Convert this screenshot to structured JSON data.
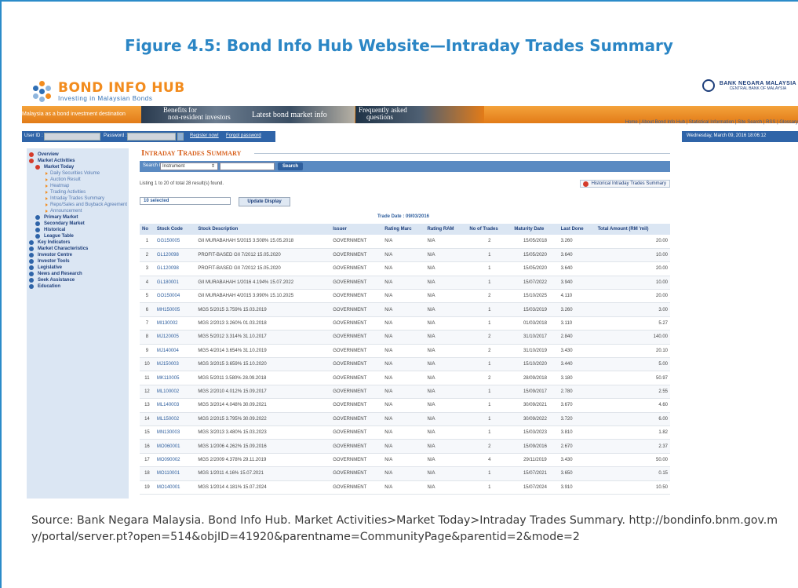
{
  "figure_title": "Figure 4.5: Bond Info Hub Website—Intraday Trades Summary",
  "site": {
    "logo_name_1": "BOND ",
    "logo_name_2": "INFO HUB",
    "logo_tagline": "Investing in Malaysian Bonds",
    "bnm_name": "BANK NEGARA MALAYSIA",
    "bnm_sub": "CENTRAL BANK OF MALAYSIA",
    "top_links": "Home | About Bond Info Hub | Statistical Information | Site Search | RSS | Glossary",
    "banner_tagline": "Malaysia as a bond investment destination",
    "banner_item_1a": "Benefits for",
    "banner_item_1b": "non-resident investors",
    "banner_item_2": "Latest bond market info",
    "banner_item_3a": "Frequently asked",
    "banner_item_3b": "questions"
  },
  "login": {
    "user_label": "User ID :",
    "password_label": "Password :",
    "register": "Register now!",
    "forgot": "Forgot password"
  },
  "date_display": "Wednesday, March 09, 2016 18:06:12",
  "sidebar": [
    {
      "label": "Overview",
      "level": "top"
    },
    {
      "label": "Market Activities",
      "level": "top"
    },
    {
      "label": "Market Today",
      "level": "l1"
    },
    {
      "label": "Daily Securities Volume",
      "level": "l2"
    },
    {
      "label": "Auction Result",
      "level": "l2"
    },
    {
      "label": "Heatmap",
      "level": "l2"
    },
    {
      "label": "Trading Activities",
      "level": "l2"
    },
    {
      "label": "Intraday Trades Summary",
      "level": "l2"
    },
    {
      "label": "Repo/Sales and Buyback Agreement",
      "level": "l2"
    },
    {
      "label": "Announcement",
      "level": "l2"
    },
    {
      "label": "Primary Market",
      "level": "l1b"
    },
    {
      "label": "Secondary Market",
      "level": "l1b"
    },
    {
      "label": "Historical",
      "level": "l1b"
    },
    {
      "label": "League Table",
      "level": "l1b"
    },
    {
      "label": "Key Indicators",
      "level": "base"
    },
    {
      "label": "Market Characteristics",
      "level": "base"
    },
    {
      "label": "Investor Centre",
      "level": "base"
    },
    {
      "label": "Investor Tools",
      "level": "base"
    },
    {
      "label": "Legislative",
      "level": "base"
    },
    {
      "label": "News and Research",
      "level": "base"
    },
    {
      "label": "Seek Assistance",
      "level": "base"
    },
    {
      "label": "Education",
      "level": "base"
    }
  ],
  "panel": {
    "title": "Intraday Trades Summary",
    "search_label": "Search by",
    "search_select": "Instrument",
    "search_button": "Search",
    "listing_text": "Listing 1 to 20  of total 28 result(s) found.",
    "historical_link": "Historical Intraday Trades Summary",
    "selected_text": "10 selected",
    "update_button": "Update Display",
    "trade_date": "Trade Date : 09/03/2016"
  },
  "table": {
    "columns": [
      "No",
      "Stock Code",
      "Stock Description",
      "Issuer",
      "Rating Marc",
      "Rating RAM",
      "No of Trades",
      "Maturity Date",
      "Last Done",
      "Total Amount (RM 'mil)"
    ],
    "rows": [
      [
        "1",
        "GG150005",
        "GII MURABAHAH 5/2015 3.508% 15.05.2018",
        "GOVERNMENT",
        "N/A",
        "N/A",
        "2",
        "15/05/2018",
        "3.260",
        "20.00"
      ],
      [
        "2",
        "GL120098",
        "PROFIT-BASED GII 7/2012 15.05.2020",
        "GOVERNMENT",
        "N/A",
        "N/A",
        "1",
        "15/05/2020",
        "3.640",
        "10.00"
      ],
      [
        "3",
        "GL120098",
        "PROFIT-BASED GII 7/2012 15.05.2020",
        "GOVERNMENT",
        "N/A",
        "N/A",
        "1",
        "15/05/2020",
        "3.640",
        "20.00"
      ],
      [
        "4",
        "GL180001",
        "GII MURABAHAH 1/2016 4.194% 15.07.2022",
        "GOVERNMENT",
        "N/A",
        "N/A",
        "1",
        "15/07/2022",
        "3.940",
        "10.00"
      ],
      [
        "5",
        "GO150004",
        "GII MURABAHAH 4/2015 3.990% 15.10.2025",
        "GOVERNMENT",
        "N/A",
        "N/A",
        "2",
        "15/10/2025",
        "4.110",
        "20.00"
      ],
      [
        "6",
        "MH150005",
        "MGS 5/2015 3.759% 15.03.2019",
        "GOVERNMENT",
        "N/A",
        "N/A",
        "1",
        "15/03/2019",
        "3.260",
        "3.00"
      ],
      [
        "7",
        "MI130002",
        "MGS 2/2013 3.260% 01.03.2018",
        "GOVERNMENT",
        "N/A",
        "N/A",
        "1",
        "01/03/2018",
        "3.110",
        "5.27"
      ],
      [
        "8",
        "MJ120005",
        "MGS 5/2012 3.314% 31.10.2017",
        "GOVERNMENT",
        "N/A",
        "N/A",
        "2",
        "31/10/2017",
        "2.840",
        "140.00"
      ],
      [
        "9",
        "MJ140004",
        "MGS 4/2014 3.654% 31.10.2019",
        "GOVERNMENT",
        "N/A",
        "N/A",
        "2",
        "31/10/2019",
        "3.430",
        "20.10"
      ],
      [
        "10",
        "MJ150003",
        "MGS 3/2015 3.659% 15.10.2020",
        "GOVERNMENT",
        "N/A",
        "N/A",
        "1",
        "15/10/2020",
        "3.440",
        "5.00"
      ],
      [
        "11",
        "MK110005",
        "MGS 5/2011 3.580% 28.09.2018",
        "GOVERNMENT",
        "N/A",
        "N/A",
        "2",
        "28/09/2018",
        "3.180",
        "50.97"
      ],
      [
        "12",
        "ML100002",
        "MGS 2/2010 4.012% 15.09.2017",
        "GOVERNMENT",
        "N/A",
        "N/A",
        "1",
        "15/09/2017",
        "2.780",
        "2.55"
      ],
      [
        "13",
        "ML140003",
        "MGS 3/2014 4.048% 30.09.2021",
        "GOVERNMENT",
        "N/A",
        "N/A",
        "1",
        "30/09/2021",
        "3.670",
        "4.60"
      ],
      [
        "14",
        "ML150002",
        "MGS 2/2015 3.795% 30.09.2022",
        "GOVERNMENT",
        "N/A",
        "N/A",
        "1",
        "30/09/2022",
        "3.720",
        "6.00"
      ],
      [
        "15",
        "MN130003",
        "MGS 3/2013 3.480% 15.03.2023",
        "GOVERNMENT",
        "N/A",
        "N/A",
        "1",
        "15/03/2023",
        "3.810",
        "1.82"
      ],
      [
        "16",
        "MO060001",
        "MGS 1/2006 4.262% 15.09.2016",
        "GOVERNMENT",
        "N/A",
        "N/A",
        "2",
        "15/09/2016",
        "2.670",
        "2.37"
      ],
      [
        "17",
        "MO090002",
        "MGS 2/2009 4.378% 29.11.2019",
        "GOVERNMENT",
        "N/A",
        "N/A",
        "4",
        "29/11/2019",
        "3.430",
        "50.00"
      ],
      [
        "18",
        "MO110001",
        "MGS 1/2011 4.16% 15.07.2021",
        "GOVERNMENT",
        "N/A",
        "N/A",
        "1",
        "15/07/2021",
        "3.650",
        "0.15"
      ],
      [
        "19",
        "MO140001",
        "MGS 1/2014 4.181% 15.07.2024",
        "GOVERNMENT",
        "N/A",
        "N/A",
        "1",
        "15/07/2024",
        "3.910",
        "10.50"
      ]
    ]
  },
  "source": "Source: Bank Negara Malaysia. Bond Info Hub. Market Activities>Market Today>Intraday Trades Summary. http://bondinfo.bnm.gov.my/portal/server.pt?open=514&objID=41920&parentname=CommunityPage&parentid=2&mode=2",
  "colors": {
    "accent": "#2b86c5",
    "banner": "#e27b18",
    "nav": "#2f64a8"
  }
}
